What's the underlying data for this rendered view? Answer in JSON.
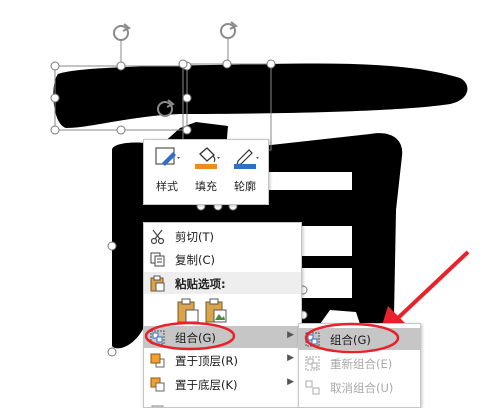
{
  "mini_toolbar": {
    "style_label": "样式",
    "fill_label": "填充",
    "outline_label": "轮廓"
  },
  "context_menu": {
    "cut": "剪切(T)",
    "copy": "复制(C)",
    "paste_options": "粘贴选项:",
    "group": "组合(G)",
    "bring_to_front": "置于顶层(R)",
    "send_to_back": "置于底层(K)"
  },
  "group_submenu": {
    "group": "组合(G)",
    "regroup": "重新组合(E)",
    "ungroup": "取消组合(U)"
  },
  "colors": {
    "accent_red": "#e8212b",
    "selection_handle": "#8a8a8a",
    "highlight": "#c6c6c6",
    "fill_orange": "#f08c1e",
    "outline_blue": "#2f6fc6"
  }
}
